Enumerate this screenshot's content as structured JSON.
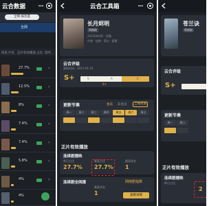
{
  "phone1": {
    "title": "云合数据",
    "toggle_label": "全网·按热度",
    "tab_label": "全网",
    "columns": [
      "排名",
      "片名",
      "正片有效播放",
      "占比",
      "操作"
    ],
    "rows": [
      {
        "rank": "1",
        "value": "27.7%"
      },
      {
        "rank": "2",
        "value": "12.5%"
      },
      {
        "rank": "3",
        "value": "8%"
      },
      {
        "rank": "4",
        "value": "7.4%"
      },
      {
        "rank": "5",
        "value": "7.4%"
      },
      {
        "rank": "6",
        "value": "5.8%"
      },
      {
        "rank": "7",
        "value": "4%"
      },
      {
        "rank": "8",
        "value": "4%"
      },
      {
        "rank": "9",
        "value": "3%"
      }
    ]
  },
  "phone2": {
    "title": "云合工具箱",
    "drama_title": "长月烬明",
    "drama_tag": "网络剧",
    "drama_meta": "2023/04/06 · 优酷",
    "drama_desc": "古装 · 仙侠 · 奇幻 · 爱情",
    "rating_title": "云合评级",
    "rating_updated": "更新时间：2023-04-10",
    "rating_grade": "S+",
    "rating_scale": [
      "S",
      "A",
      "B"
    ],
    "rating_pointer": "S+",
    "schedule_title": "更新节奏",
    "schedule_tabs": [
      "会员",
      "非会员",
      "上线周期"
    ],
    "schedule_days": [
      "周一",
      "周二",
      "周三",
      "周四",
      "周五",
      "周六",
      "周日"
    ],
    "play_section_title": "正片有效播放",
    "play_card1_title": "连续剧播映",
    "play_card1_label1": "昨日占比",
    "play_card1_value1": "27.7%",
    "play_card1_label2": "最高占比",
    "play_card1_value2": "27.7%",
    "play_card1_label3": "最高排名",
    "play_card1_value3": "1",
    "play_card2_title": "连续剧全网播",
    "play_card2_label": "网络剧指数",
    "play_card2_label2": "最高排名",
    "play_card2_value2": "1",
    "play_card2_button": "查看详情"
  },
  "phone3": {
    "drama_title": "苍兰诀",
    "drama_tag": "网络剧",
    "rating_title": "云合评级",
    "rating_grade": "S+",
    "schedule_title": "更新节奏",
    "schedule_days": [
      "周一",
      "周二"
    ],
    "play_section_title": "正片有效播放",
    "play_card1_title": "连续剧播映",
    "play_card1_label1": "昨日占比",
    "play_card1_value1": "2"
  },
  "colors": {
    "accent": "#e0b24a",
    "bg": "#1c1f24",
    "card": "#2a2e36",
    "highlight": "#e0282c",
    "green": "#3da35d"
  }
}
